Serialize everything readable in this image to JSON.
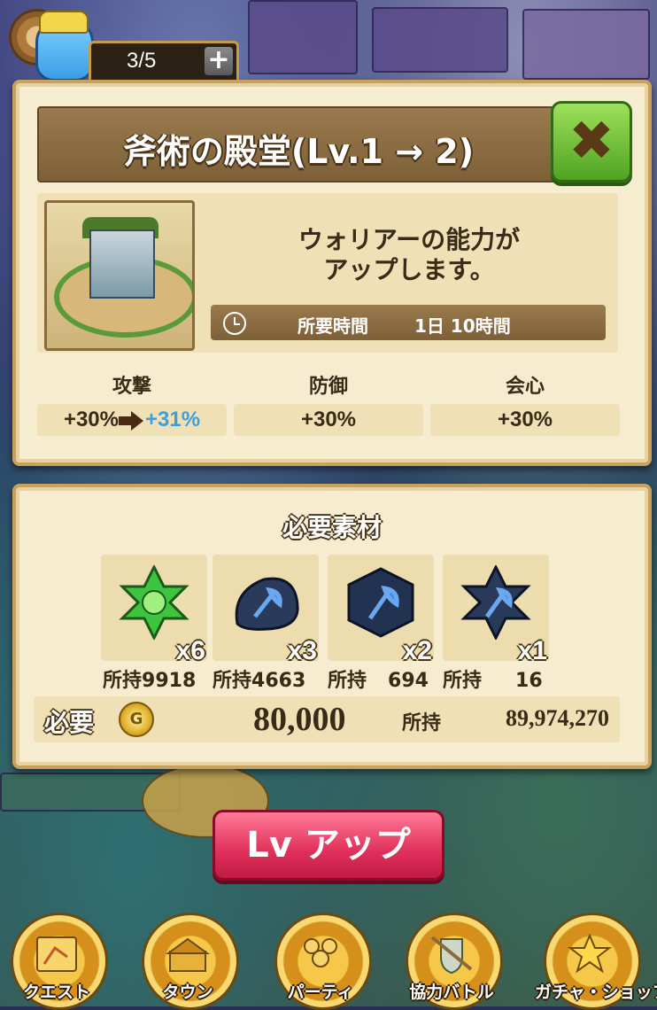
{
  "header": {
    "stamina": "3/5",
    "stamina_plus": "+"
  },
  "dialog": {
    "title": "斧術の殿堂(Lv.1 → 2)",
    "close": "✖",
    "description_line1": "ウォリアーの能力が",
    "description_line2": "アップします。",
    "time_label": "所要時間",
    "time_value": "1日 10時間",
    "stats": [
      {
        "label": "攻撃",
        "current": "+30%",
        "next": "+31%"
      },
      {
        "label": "防御",
        "value": "+30%"
      },
      {
        "label": "会心",
        "value": "+30%"
      }
    ]
  },
  "materials": {
    "title": "必要素材",
    "items": [
      {
        "icon": "green-star-gem-icon",
        "count": "x6",
        "owned_label": "所持",
        "owned_value": "9918"
      },
      {
        "icon": "blue-axe-slime-icon",
        "count": "x3",
        "owned_label": "所持",
        "owned_value": "4663"
      },
      {
        "icon": "blue-axe-hexagon-icon",
        "count": "x2",
        "owned_label": "所持",
        "owned_value": "694"
      },
      {
        "icon": "blue-axe-star-icon",
        "count": "x1",
        "owned_label": "所持",
        "owned_value": "16"
      }
    ],
    "need_label": "必要",
    "coin_symbol": "G",
    "cost": "80,000",
    "own_label": "所持",
    "own_value": "89,974,270"
  },
  "lvup_label": "Lv アップ",
  "nav": [
    {
      "label": "クエスト",
      "icon": "quest-map-icon"
    },
    {
      "label": "タウン",
      "icon": "town-icon"
    },
    {
      "label": "パーティ",
      "icon": "party-icon"
    },
    {
      "label": "協力バトル",
      "icon": "coop-battle-icon"
    },
    {
      "label": "ガチャ・ショップ",
      "icon": "gacha-star-icon"
    }
  ],
  "colors": {
    "panel_bg": "#f6ecd0",
    "close_green": "#4fa322",
    "lvup_red": "#e0305a",
    "new_stat_blue": "#3aa0e0"
  }
}
